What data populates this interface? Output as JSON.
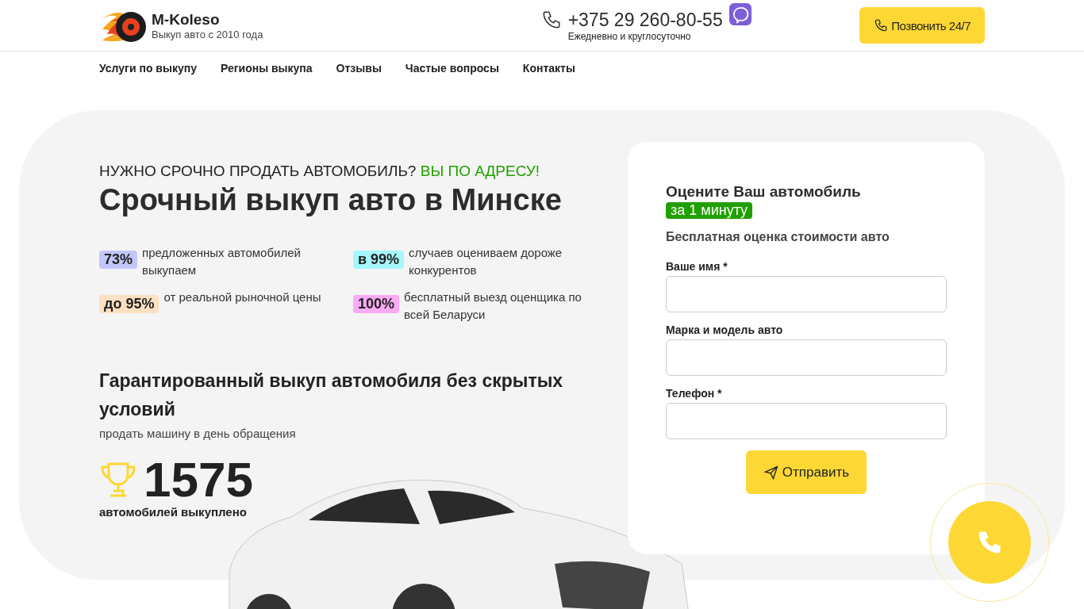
{
  "header": {
    "brand": "M-Koleso",
    "tagline": "Выкуп авто с 2010 года",
    "phone": "+375 29 260-80-55",
    "hours": "Ежедневно и круглосуточно",
    "call_button": "Позвонить 24/7"
  },
  "nav": [
    "Услуги по выкупу",
    "Регионы выкупа",
    "Отзывы",
    "Частые вопросы",
    "Контакты"
  ],
  "hero": {
    "kicker": "НУЖНО СРОЧНО ПРОДАТЬ АВТОМОБИЛЬ?",
    "kicker_accent": "ВЫ ПО АДРЕСУ!",
    "title": "Срочный выкуп авто в Минске",
    "stats": [
      {
        "badge": "73%",
        "text": "предложенных автомобилей выкупаем",
        "color": "#c3c6fb"
      },
      {
        "badge": "в 99%",
        "text": "случаев оцениваем дороже конкурентов",
        "color": "#a5f7fb"
      },
      {
        "badge": "до 95%",
        "text": "от реальной рыночной цены",
        "color": "#fde0c2"
      },
      {
        "badge": "100%",
        "text": "бесплатный выезд оценщика по всей Беларуси",
        "color": "#fbaaf4"
      }
    ],
    "guarantee": "Гарантированный выкуп автомобиля без скрытых условий",
    "guarantee_sub": "продать машину в день обращения",
    "counter": "1575",
    "counter_label": "автомобилей выкуплено"
  },
  "form": {
    "title": "Оцените Ваш автомобиль",
    "badge": "за 1 минуту",
    "subtitle": "Бесплатная оценка стоимости авто",
    "fields": [
      {
        "label": "Ваше имя *"
      },
      {
        "label": "Марка и модель авто"
      },
      {
        "label": "Телефон *"
      }
    ],
    "submit": "Отправить"
  }
}
